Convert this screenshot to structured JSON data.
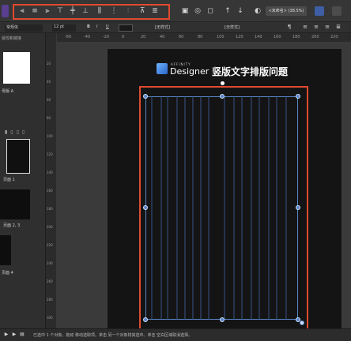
{
  "context": {
    "font_name": "常规体",
    "font_size": "12 pt",
    "style_bold": "B",
    "style_italic": "I",
    "style_underline": "U",
    "para_style": "[无样式]",
    "char_style": "[无样式]"
  },
  "toolbar": {
    "zoom_label": "<未命名> (38.5%)"
  },
  "ruler": {
    "ticks": [
      "-60",
      "-40",
      "-20",
      "0",
      "20",
      "40",
      "60",
      "80",
      "100",
      "120",
      "140",
      "160",
      "180",
      "200",
      "220"
    ],
    "vticks": [
      "20",
      "40",
      "60",
      "80",
      "100",
      "120",
      "140",
      "160",
      "180",
      "200",
      "220",
      "240",
      "260",
      "280",
      "300"
    ]
  },
  "left_panel": {
    "tab_label": "受控和链接",
    "artboard_label": "母版 A",
    "page1_label": "页面 1",
    "page23_label": "页面 2, 3",
    "page4_label": "页面 4"
  },
  "banner": {
    "affinity_label": "AFFINITY",
    "app_name": "Designer",
    "title": "竖版文字排版问题"
  },
  "status": {
    "text": "已选中 1 个对象。拖动 移动选取项。单击 另一个对象将其选中。单击 空白区域取消选择。"
  },
  "colors": {
    "highlight": "#e04a2f",
    "accent": "#5a86c6",
    "guide": "#3f63a8",
    "canvas": "#3a3a3a",
    "artboard": "#141414"
  }
}
